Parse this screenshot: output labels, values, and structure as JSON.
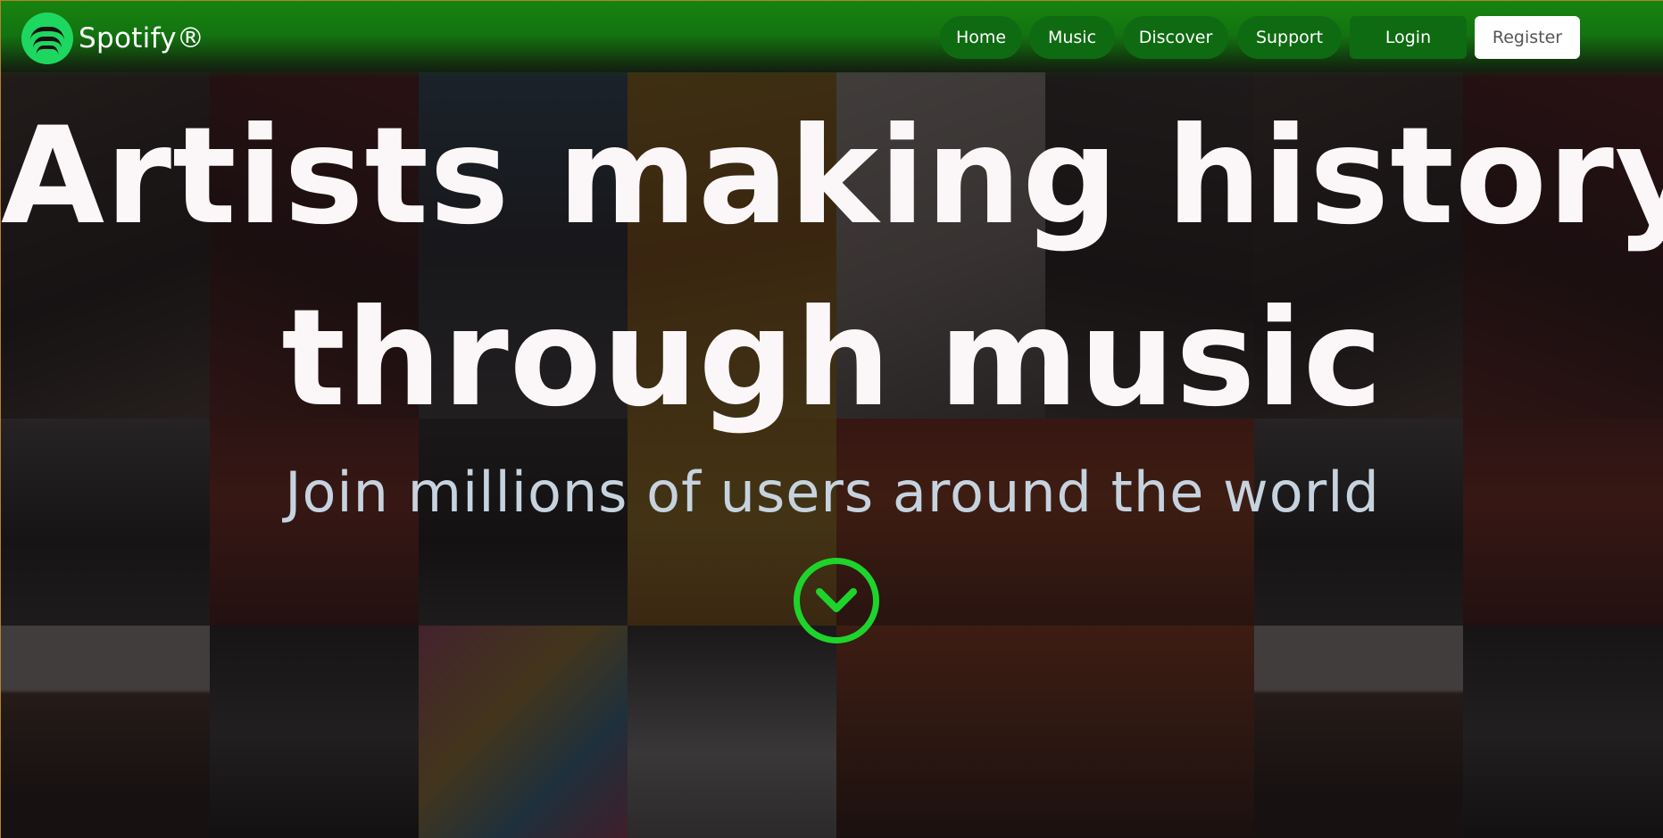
{
  "brand": {
    "name": "Spotify®",
    "logo_icon": "spotify-logo-icon",
    "accent": "#1ed760"
  },
  "nav": {
    "items": [
      {
        "label": "Home"
      },
      {
        "label": "Music"
      },
      {
        "label": "Discover"
      },
      {
        "label": "Support"
      }
    ],
    "login_label": "Login",
    "register_label": "Register"
  },
  "hero": {
    "title_line1": "Artists making history",
    "title_line2": "through music",
    "subtitle": "Join millions of users around the world",
    "scroll_icon": "chevron-down-icon"
  },
  "colors": {
    "header_green": "#17840f",
    "nav_pill": "#0f6b12",
    "scroll_ring": "#1ed42b",
    "title": "#fbf7f8",
    "subtitle": "#c6d3df"
  }
}
